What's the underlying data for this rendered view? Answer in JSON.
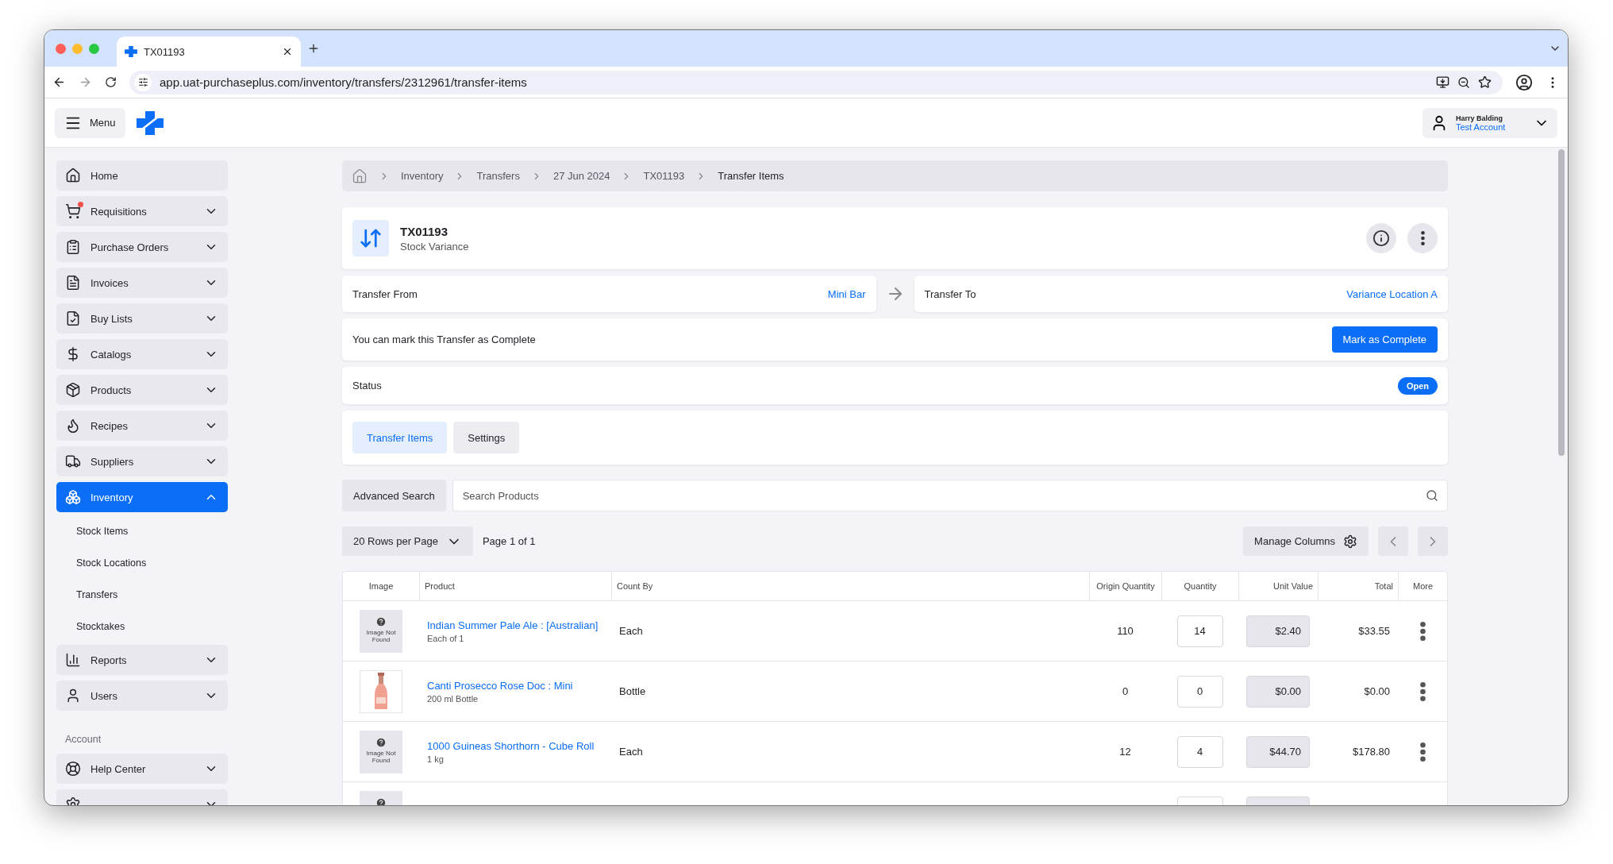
{
  "browser": {
    "tab_title": "TX01193",
    "url": "app.uat-purchaseplus.com/inventory/transfers/2312961/transfer-items"
  },
  "header": {
    "menu_label": "Menu",
    "user_name": "Harry Balding",
    "account": "Test Account"
  },
  "sidebar": {
    "items": [
      {
        "label": "Home",
        "expandable": false,
        "selected": false,
        "notification": false
      },
      {
        "label": "Requisitions",
        "expandable": true,
        "expanded": false,
        "selected": false,
        "notification": true
      },
      {
        "label": "Purchase Orders",
        "expandable": true,
        "expanded": false,
        "selected": false,
        "notification": false
      },
      {
        "label": "Invoices",
        "expandable": true,
        "expanded": false,
        "selected": false,
        "notification": false
      },
      {
        "label": "Buy Lists",
        "expandable": true,
        "expanded": false,
        "selected": false,
        "notification": false
      },
      {
        "label": "Catalogs",
        "expandable": true,
        "expanded": false,
        "selected": false,
        "notification": false
      },
      {
        "label": "Products",
        "expandable": true,
        "expanded": false,
        "selected": false,
        "notification": false
      },
      {
        "label": "Recipes",
        "expandable": true,
        "expanded": false,
        "selected": false,
        "notification": false
      },
      {
        "label": "Suppliers",
        "expandable": true,
        "expanded": false,
        "selected": false,
        "notification": false
      },
      {
        "label": "Inventory",
        "expandable": true,
        "expanded": true,
        "selected": true,
        "notification": false,
        "children": [
          {
            "label": "Stock Items"
          },
          {
            "label": "Stock Locations"
          },
          {
            "label": "Transfers"
          },
          {
            "label": "Stocktakes"
          }
        ]
      },
      {
        "label": "Reports",
        "expandable": true,
        "expanded": false,
        "selected": false,
        "notification": false
      },
      {
        "label": "Users",
        "expandable": true,
        "expanded": false,
        "selected": false,
        "notification": false
      }
    ],
    "section": "Account",
    "account_items": [
      {
        "label": "Help Center",
        "expandable": true,
        "expanded": false,
        "selected": false,
        "notification": false
      },
      {
        "expandable": true,
        "expanded": false,
        "selected": false,
        "notification": false
      }
    ]
  },
  "breadcrumb": [
    "Inventory",
    "Transfers",
    "27 Jun 2024",
    "TX01193",
    "Transfer Items"
  ],
  "transfer": {
    "id": "TX01193",
    "type": "Stock Variance",
    "from_label": "Transfer From",
    "from": "Mini Bar",
    "to_label": "Transfer To",
    "to": "Variance Location A",
    "complete_message": "You can mark this Transfer as Complete",
    "complete_button": "Mark as Complete",
    "status_label": "Status",
    "status": "Open"
  },
  "tabs": [
    {
      "label": "Transfer Items",
      "selected": true
    },
    {
      "label": "Settings",
      "selected": false
    }
  ],
  "search": {
    "button": "Advanced Search",
    "placeholder": "Search Products"
  },
  "pagination": {
    "rows_per_page": "20 Rows per Page",
    "page": "Page 1 of 1",
    "manage_columns": "Manage Columns"
  },
  "table": {
    "columns": [
      "Image",
      "Product",
      "Count By",
      "Origin Quantity",
      "Quantity",
      "Unit Value",
      "Total",
      "More"
    ],
    "rows": [
      {
        "kind": "placeholder",
        "image_text": "Image Not Found",
        "product": "Indian Summer Pale Ale : [Australian]",
        "size": "Each of 1",
        "count_by": "Each",
        "origin_quantity": "110",
        "quantity": "14",
        "unit_value": "$2.40",
        "total": "$33.55"
      },
      {
        "kind": "picture",
        "product": "Canti Prosecco Rose Doc : Mini",
        "size": "200 ml Bottle",
        "count_by": "Bottle",
        "origin_quantity": "0",
        "quantity": "0",
        "unit_value": "$0.00",
        "total": "$0.00"
      },
      {
        "kind": "placeholder",
        "image_text": "Image Not Found",
        "product": "1000 Guineas Shorthorn - Cube Roll",
        "size": "1 kg",
        "count_by": "Each",
        "origin_quantity": "12",
        "quantity": "4",
        "unit_value": "$44.70",
        "total": "$178.80"
      },
      {
        "kind": "placeholder"
      }
    ]
  }
}
